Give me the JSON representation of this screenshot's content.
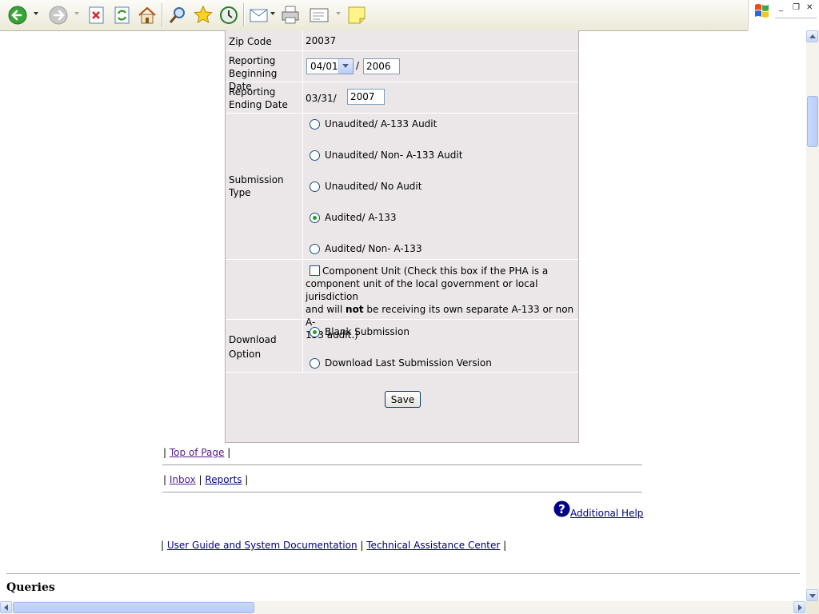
{
  "toolbar": {
    "icons": [
      "back-icon",
      "forward-icon",
      "stop-icon",
      "refresh-icon",
      "home-icon",
      "search-icon",
      "favorites-icon",
      "history-icon",
      "mail-icon",
      "print-icon",
      "edit-icon",
      "note-icon"
    ]
  },
  "window": {
    "minimize": "_",
    "restore": "❐",
    "close": "✕"
  },
  "form": {
    "zip_label": "Zip Code",
    "zip_value": "20037",
    "begin_label_1": "Reporting",
    "begin_label_2": "Beginning Date",
    "begin_month": "04/01",
    "slash": "/",
    "begin_year": "2006",
    "end_label_1": "Reporting",
    "end_label_2": "Ending Date",
    "end_month": "03/31/",
    "end_year": "2007",
    "submission_label_1": "Submission",
    "submission_label_2": "Type",
    "submission_options": [
      {
        "label": "Unaudited/ A-133 Audit",
        "selected": false
      },
      {
        "label": "Unaudited/ Non- A-133 Audit",
        "selected": false
      },
      {
        "label": "Unaudited/ No Audit",
        "selected": false
      },
      {
        "label": "Audited/ A-133",
        "selected": true
      },
      {
        "label": "Audited/ Non- A-133",
        "selected": false
      }
    ],
    "component_line1": "Component Unit (Check this box if the PHA is a",
    "component_line2": "component unit of the local government or local jurisdiction",
    "component_line3_a": "and will ",
    "component_line3_bold": "not",
    "component_line3_b": " be receiving its own separate A-133 or non A-",
    "component_line4": "133 audit.)",
    "download_label_1": "Download",
    "download_label_2": "Option",
    "download_options": [
      {
        "label": "Blank Submission",
        "selected": true
      },
      {
        "label": "Download Last Submission Version",
        "selected": false
      }
    ],
    "save_label": "Save"
  },
  "footer": {
    "pipe": "|",
    "top_of_page": "Top of Page",
    "inbox": "Inbox",
    "reports": "Reports",
    "additional_help": "Additional Help",
    "user_guide": "User Guide and System Documentation",
    "tac": "Technical Assistance Center",
    "queries": "Queries"
  }
}
